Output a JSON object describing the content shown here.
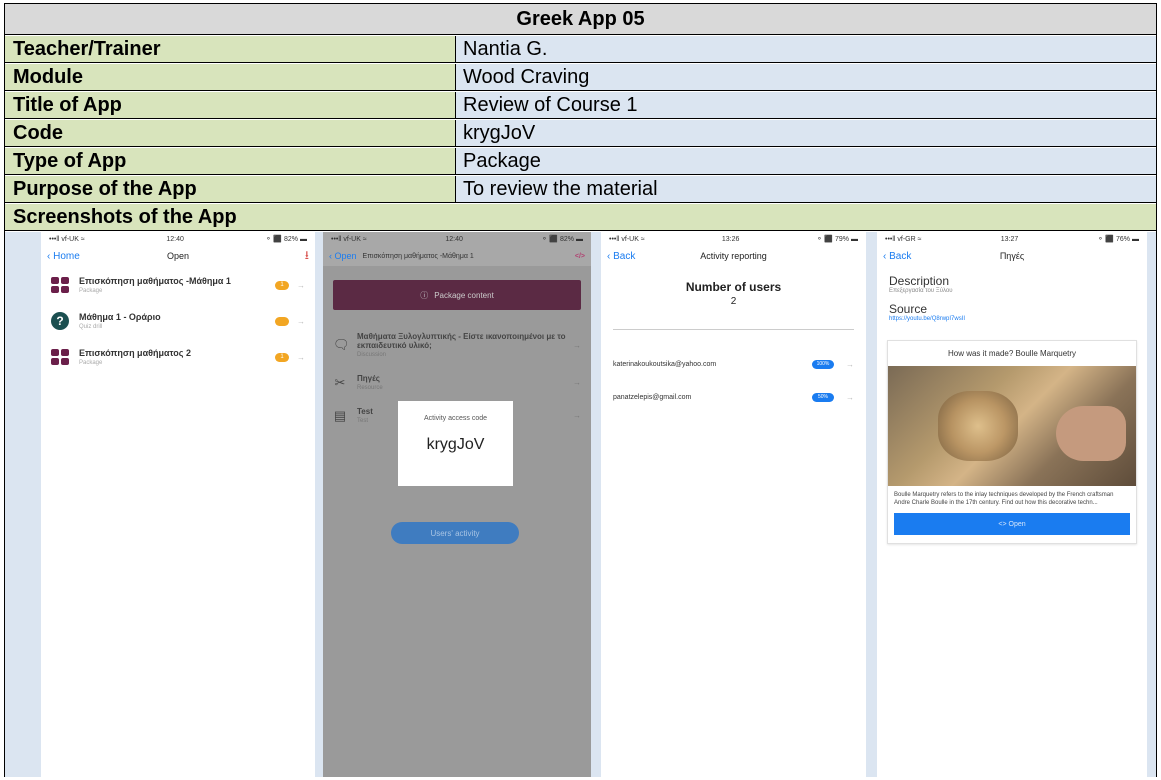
{
  "doc_title": "Greek App 05",
  "rows": [
    {
      "label": "Teacher/Trainer",
      "value": "Nantia G."
    },
    {
      "label": "Module",
      "value": "Wood Craving"
    },
    {
      "label": "Title of App",
      "value": "Review of Course 1"
    },
    {
      "label": "Code",
      "value": "krygJoV"
    },
    {
      "label": "Type of App",
      "value": "Package"
    },
    {
      "label": "Purpose of the App",
      "value": "To review the material"
    }
  ],
  "screenshots_heading": "Screenshots of the App",
  "phone1": {
    "carrier": "•••ll vf-UK ≈",
    "time": "12:40",
    "battery": "⚬ ⬛ 82% ▬",
    "back_label": "Home",
    "nav_title": "Open",
    "download_icon": "download-icon",
    "items": [
      {
        "title": "Επισκόπηση μαθήματος -Μάθημα 1",
        "subtitle": "Package",
        "badge": "1"
      },
      {
        "title": "Μάθημα 1 - Οράριο",
        "subtitle": "Quiz drill",
        "badge": ""
      },
      {
        "title": "Επισκόπηση μαθήματος 2",
        "subtitle": "Package",
        "badge": "1"
      }
    ]
  },
  "phone2": {
    "carrier": "•••ll vf-UK ≈",
    "time": "12:40",
    "battery": "⚬ ⬛ 82% ▬",
    "back_label": "Open",
    "nav_title": "Επισκόπηση μαθήματος -Μάθημα 1",
    "code_icon": "</>",
    "package_content": "Package content",
    "items": [
      {
        "title": "Μαθήματα Ξυλογλυπτικής - Είστε ικανοποιημένοι με το εκπαιδευτικό υλικό;",
        "subtitle": "Discussion"
      },
      {
        "title": "Πηγές",
        "subtitle": "Resource"
      },
      {
        "title": "Test",
        "subtitle": "Test"
      }
    ],
    "access_label": "Activity access code",
    "access_code": "krygJoV",
    "users_activity": "Users' activity"
  },
  "phone3": {
    "carrier": "•••ll vf-UK ≈",
    "time": "13:26",
    "battery": "⚬ ⬛ 79% ▬",
    "back_label": "Back",
    "nav_title": "Activity reporting",
    "users_label": "Number of users",
    "users_count": "2",
    "users": [
      {
        "email": "katerinakoukoutsika@yahoo.com",
        "score": "100%"
      },
      {
        "email": "panatzelepis@gmail.com",
        "score": "50%"
      }
    ]
  },
  "phone4": {
    "carrier": "•••ll vf-GR ≈",
    "time": "13:27",
    "battery": "⚬ ⬛ 76% ▬",
    "back_label": "Back",
    "nav_title": "Πηγές",
    "description_label": "Description",
    "description_text": "Επεξεργασία του Ξύλου",
    "source_label": "Source",
    "source_link": "https://youtu.be/Q8rwpI7wsII",
    "card_title": "How was it made? Boulle Marquetry",
    "card_desc": "Boulle Marquetry refers to the inlay techniques developed by the French craftsman Andre Charle Boulle in the 17th century. Find out how this decorative techn...",
    "open_label": "<> Open"
  }
}
